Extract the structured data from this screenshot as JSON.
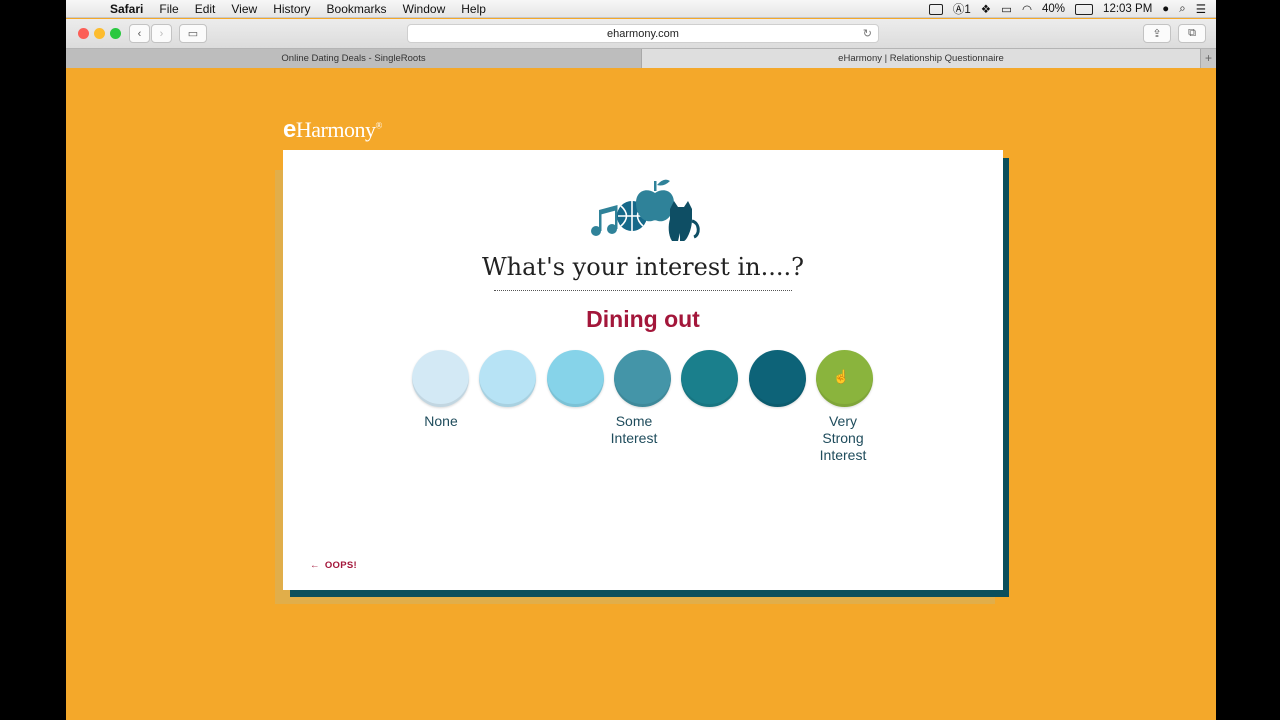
{
  "menubar": {
    "app": "Safari",
    "items": [
      "File",
      "Edit",
      "View",
      "History",
      "Bookmarks",
      "Window",
      "Help"
    ],
    "status": {
      "display_num": "1",
      "battery": "40%",
      "time": "12:03 PM"
    }
  },
  "toolbar": {
    "url": "eharmony.com"
  },
  "tabs": [
    "Online Dating Deals - SingleRoots",
    "eHarmony | Relationship Questionnaire"
  ],
  "page": {
    "logo_e": "e",
    "logo_rest": "Harmony",
    "logo_mark": "®",
    "question": "What's your interest in....?",
    "topic": "Dining out",
    "options": [
      {
        "label": "None",
        "color": "#d3e9f5"
      },
      {
        "label": "",
        "color": "#b7e3f5"
      },
      {
        "label": "Some\nInterest",
        "color": "#86d3e9"
      },
      {
        "label": "",
        "color": "#4495a8"
      },
      {
        "label": "",
        "color": "#1a7f8c"
      },
      {
        "label": "",
        "color": "#0d6378"
      },
      {
        "label": "Very\nStrong\nInterest",
        "color": "#8ab43d",
        "selected": true
      }
    ],
    "oops_label": "OOPS!",
    "oops_icon": "arrow-left-icon"
  },
  "colors": {
    "background": "#f4a82a",
    "accent": "#a3163a",
    "card_shadow": "#0b4f5c"
  }
}
